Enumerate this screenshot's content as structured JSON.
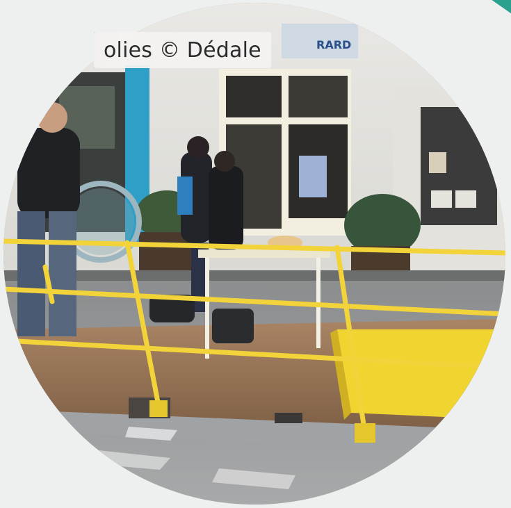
{
  "photo": {
    "credit": "olies © Dédale",
    "storefront_sign": "RARD",
    "description_icon": "photo-icon"
  },
  "colors": {
    "background": "#eef0ef",
    "accent": "#2aa08e",
    "railing_yellow": "#f2d43a",
    "storefront_blue": "#2f9fc7",
    "deck_wood": "#9c7b5c"
  }
}
